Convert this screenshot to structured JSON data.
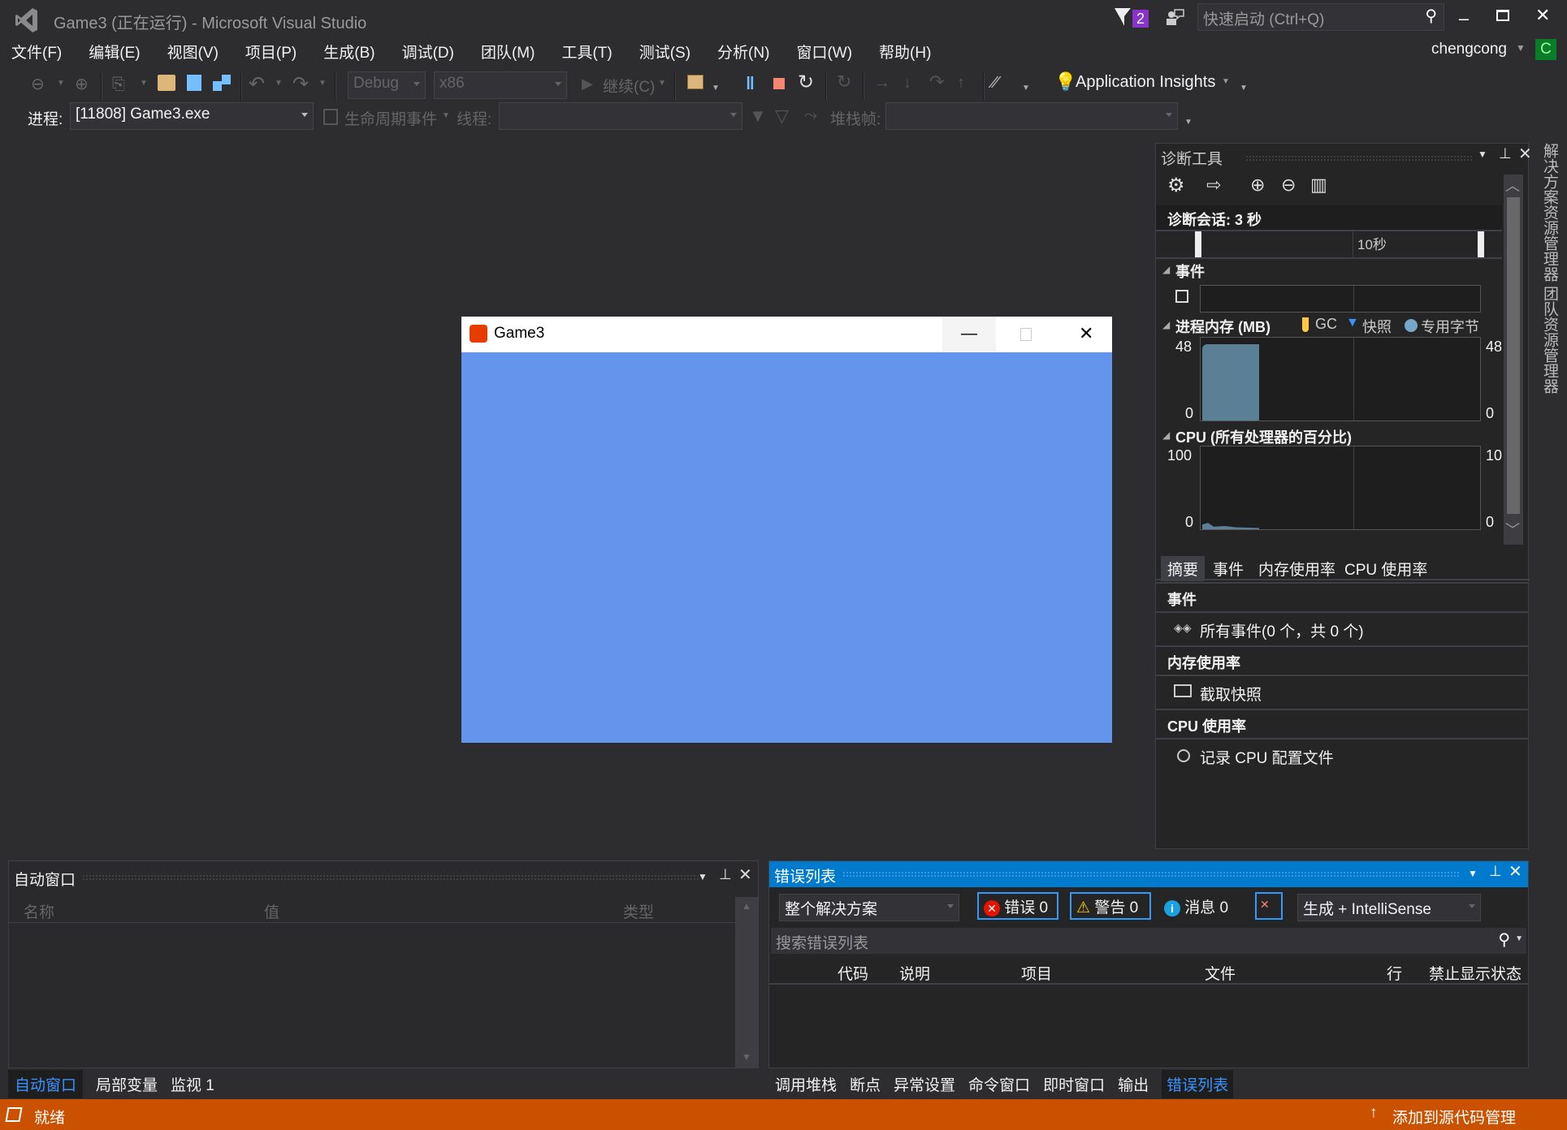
{
  "titlebar": {
    "title": "Game3 (正在运行) - Microsoft Visual Studio",
    "notification_count": "2",
    "quick_launch_placeholder": "快速启动 (Ctrl+Q)",
    "user": "chengcong",
    "user_initial": "C"
  },
  "menu": [
    "文件(F)",
    "编辑(E)",
    "视图(V)",
    "项目(P)",
    "生成(B)",
    "调试(D)",
    "团队(M)",
    "工具(T)",
    "测试(S)",
    "分析(N)",
    "窗口(W)",
    "帮助(H)"
  ],
  "toolbar": {
    "config": "Debug",
    "platform": "x86",
    "continue_label": "继续(C)",
    "app_insights": "Application Insights"
  },
  "debug_toolbar": {
    "process_label": "进程:",
    "process_value": "[11808] Game3.exe",
    "lifecycle_label": "生命周期事件",
    "thread_label": "线程:",
    "stackframe_label": "堆栈帧:"
  },
  "game_window": {
    "title": "Game3",
    "bg_color": "#6495ed"
  },
  "diagnostics": {
    "title": "诊断工具",
    "session": "诊断会话: 3 秒",
    "timeline_label": "10秒",
    "events_header": "事件",
    "memory_header": "进程内存 (MB)",
    "legend": {
      "gc": "GC",
      "snapshot": "快照",
      "private": "专用字节"
    },
    "memory_axis": {
      "max": "48",
      "min": "0",
      "max_r": "48",
      "min_r": "0"
    },
    "cpu_header": "CPU (所有处理器的百分比)",
    "cpu_axis": {
      "max": "100",
      "min": "0",
      "max_r": "10",
      "min_r": "0"
    },
    "tabs": [
      "摘要",
      "事件",
      "内存使用率",
      "CPU 使用率"
    ],
    "sections": {
      "events": "事件",
      "all_events": "所有事件(0 个，共 0 个)",
      "memory": "内存使用率",
      "snapshot": "截取快照",
      "cpu": "CPU 使用率",
      "record_cpu": "记录 CPU 配置文件"
    }
  },
  "side_tabs": [
    "解决方案资源管理器",
    "团队资源管理器"
  ],
  "autos": {
    "title": "自动窗口",
    "columns": [
      "名称",
      "值",
      "类型"
    ],
    "tabs": [
      "自动窗口",
      "局部变量",
      "监视 1"
    ]
  },
  "errors": {
    "title": "错误列表",
    "scope": "整个解决方案",
    "errors": "错误 0",
    "warnings": "警告 0",
    "messages": "消息 0",
    "source": "生成 + IntelliSense",
    "search_placeholder": "搜索错误列表",
    "columns": [
      "代码",
      "说明",
      "项目",
      "文件",
      "行",
      "禁止显示状态"
    ],
    "tabs": [
      "调用堆栈",
      "断点",
      "异常设置",
      "命令窗口",
      "即时窗口",
      "输出",
      "错误列表"
    ]
  },
  "status": {
    "text": "就绪",
    "source_control": "添加到源代码管理"
  }
}
